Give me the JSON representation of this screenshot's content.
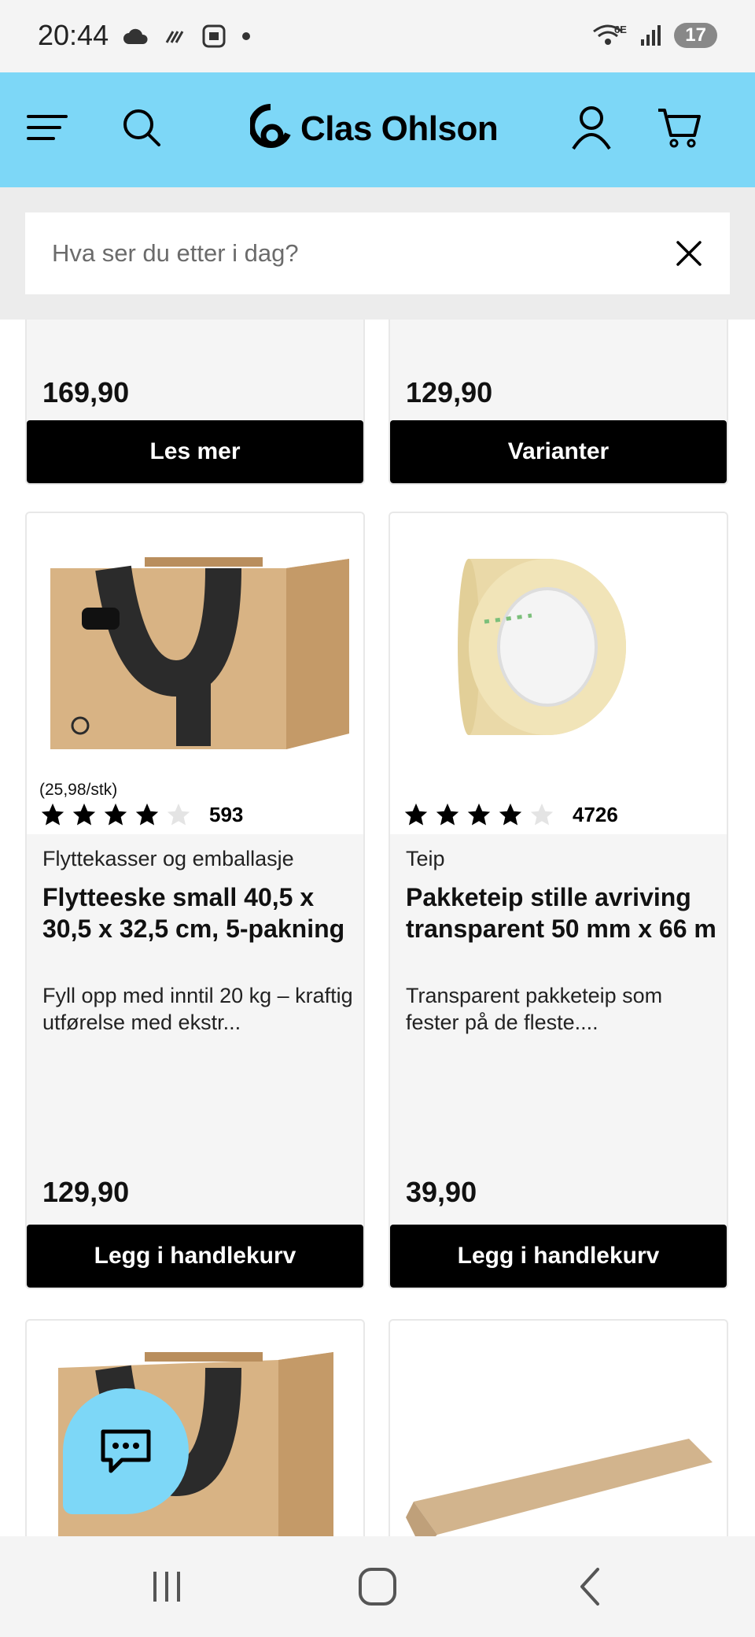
{
  "status_bar": {
    "time": "20:44",
    "network": "6E",
    "battery": "17",
    "icons": [
      "cloud-icon",
      "data-activity-icon",
      "screenshot-icon",
      "dot-icon",
      "wifi-icon",
      "signal-icon"
    ]
  },
  "header": {
    "brand": "Clas Ohlson",
    "accent_color": "#7dd7f7",
    "icons": [
      "menu-icon",
      "search-icon",
      "account-icon",
      "cart-icon"
    ]
  },
  "search": {
    "placeholder": "Hva ser du etter i dag?"
  },
  "products": {
    "top_row": [
      {
        "price": "169,90",
        "button": "Les mer"
      },
      {
        "price": "129,90",
        "button": "Varianter"
      }
    ],
    "main_row": [
      {
        "unit_price": "(25,98/stk)",
        "rating": 4,
        "rating_count": "593",
        "category": "Flyttekasser og emballasje",
        "title": "Flytteeske small 40,5 x 30,5 x 32,5 cm, 5-pakning",
        "description": "Fyll opp med inntil 20 kg – kraftig utførelse med ekstr...",
        "price": "129,90",
        "button": "Legg i handlekurv"
      },
      {
        "unit_price": "",
        "rating": 4,
        "rating_count": "4726",
        "category": "Teip",
        "title": "Pakketeip stille avriving transparent 50 mm x 66 m",
        "description": "Transparent pakketeip som fester på de fleste....",
        "price": "39,90",
        "button": "Legg i handlekurv"
      }
    ]
  },
  "chat": {
    "icon": "chat-icon"
  },
  "nav": {
    "icons": [
      "recent-apps-icon",
      "home-icon",
      "back-icon"
    ]
  }
}
